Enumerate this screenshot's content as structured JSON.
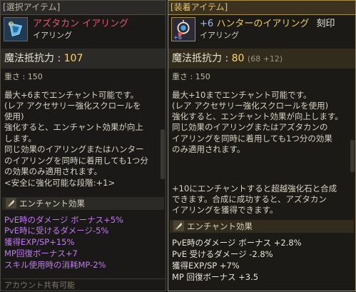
{
  "left": {
    "header": "[選択アイテム]",
    "item_name": "アズタカン イアリング",
    "item_type": "イアリング",
    "stat_label": "魔法抵抗力 :",
    "stat_value": "107",
    "weight_label": "重さ :",
    "weight_value": "150",
    "desc_lines": [
      "最大+6までエンチャント可能です。",
      "(レア アクセサリー強化スクロールを",
      "使用)",
      "強化すると、エンチャント効果が向上",
      "します。",
      "同じ効果のイアリングまたはハンター",
      "のイアリングを同時に着用しても1つ分",
      "の効果のみ適用されます。",
      "<安全に強化可能な段階:+1>"
    ],
    "section_title": "エンチャント効果",
    "effects": [
      "PvE時のダメージ ボーナス+5%",
      "PvE時に受けるダメージ-5%",
      "獲得EXP/SP+15%",
      "MP回復ボーナス+7",
      "スキル使用時の消耗MP-2%"
    ],
    "footer": "アカウント共有可能"
  },
  "right": {
    "header": "[装着アイテム]",
    "enchant": "+6",
    "item_name": "ハンターのイアリング",
    "engraved": "刻印",
    "item_type": "イアリング",
    "icon_badge": "+6",
    "stat_label": "魔法抵抗力 :",
    "stat_value": "80",
    "stat_extra": "(68 +12)",
    "weight_label": "重さ :",
    "weight_value": "150",
    "desc_lines": [
      "最大+10までエンチャント可能です。",
      "(レア アクセサリー強化スクロールを使用)",
      "強化すると、エンチャント効果が向上します。",
      "同じ効果のイアリングまたはアズタカンの",
      "イアリングを同時に着用しても1つ分の効果",
      "のみ適用されます。",
      "",
      "+10にエンチャントすると超越強化石と合成",
      "できます。合成に成功すると、アズタカン",
      "イアリングを獲得できます。"
    ],
    "section_title": "エンチャント効果",
    "effects": [
      "PvE時のダメージ ボーナス +2.8%",
      "PvE 受けるダメージ -2.8%",
      "獲得EXP/SP +7%",
      "MP 回復ボーナス +3.5"
    ]
  },
  "colors": {
    "left_name": "#e0586e",
    "right_name": "#f2cc5a",
    "enchant": "#9fb8ff",
    "stat_value": "#ffd36a",
    "left_effects": "#c07af0"
  }
}
